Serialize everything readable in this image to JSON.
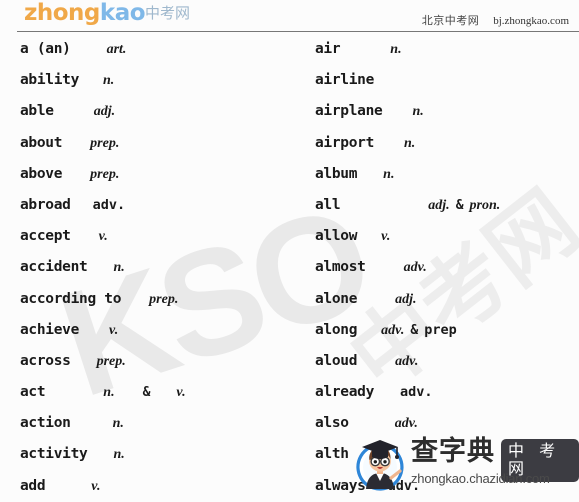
{
  "header": {
    "logo_part1": "zhong",
    "logo_part2": "kao",
    "logo_cn": "中考网",
    "site_cn": "北京中考网",
    "site_url": "bj.zhongkao.com"
  },
  "background_watermark": {
    "text": "KSO",
    "cn_text": "中考网"
  },
  "corner_watermark": {
    "brand_cn": "查字典",
    "badge_cn": "中 考 网",
    "url": "zhongkao.chazidian.com",
    "mascot": "graduate-mascot-icon"
  },
  "word_list": {
    "left_column": [
      {
        "word": "a (an)",
        "pos": "art.",
        "pos_style": "italic",
        "indent": 36
      },
      {
        "word": "ability",
        "pos": "n.",
        "pos_style": "italic",
        "indent": 24
      },
      {
        "word": "able",
        "pos": "adj.",
        "pos_style": "italic",
        "indent": 40
      },
      {
        "word": "about",
        "pos": "prep.",
        "pos_style": "italic",
        "indent": 28
      },
      {
        "word": "above",
        "pos": "prep.",
        "pos_style": "italic",
        "indent": 28
      },
      {
        "word": "abroad",
        "pos": "adv.",
        "pos_style": "upright",
        "indent": 22
      },
      {
        "word": "accept",
        "pos": "v.",
        "pos_style": "italic",
        "indent": 28
      },
      {
        "word": "accident",
        "pos": "n.",
        "pos_style": "italic",
        "indent": 26
      },
      {
        "word": "according to",
        "pos": "prep.",
        "pos_style": "italic",
        "indent": 28
      },
      {
        "word": "achieve",
        "pos": "v.",
        "pos_style": "italic",
        "indent": 30
      },
      {
        "word": "across",
        "pos": "prep.",
        "pos_style": "italic",
        "indent": 26
      },
      {
        "word": "act",
        "pos": "n.",
        "pos_style": "italic",
        "indent": 58,
        "pos2": "v.",
        "amp": "&",
        "gap2": 28,
        "gap3": 26
      },
      {
        "word": "action",
        "pos": "n.",
        "pos_style": "italic",
        "indent": 42
      },
      {
        "word": "activity",
        "pos": "n.",
        "pos_style": "italic",
        "indent": 26
      },
      {
        "word": "add",
        "pos": "v.",
        "pos_style": "italic",
        "indent": 46
      }
    ],
    "right_column": [
      {
        "word": "air",
        "pos": "n.",
        "pos_style": "italic",
        "indent": 50
      },
      {
        "word": "airline",
        "pos": "",
        "pos_style": "italic",
        "indent": 0
      },
      {
        "word": "airplane",
        "pos": "n.",
        "pos_style": "italic",
        "indent": 30
      },
      {
        "word": "airport",
        "pos": "n.",
        "pos_style": "italic",
        "indent": 30
      },
      {
        "word": "album",
        "pos": "n.",
        "pos_style": "italic",
        "indent": 26
      },
      {
        "word": "all",
        "pos": "adj.",
        "pos_style": "italic",
        "indent": 88,
        "pos2": "pron.",
        "amp": "&",
        "gap2": 6,
        "gap3": 6
      },
      {
        "word": "allow",
        "pos": "v.",
        "pos_style": "italic",
        "indent": 24
      },
      {
        "word": "almost",
        "pos": "adv.",
        "pos_style": "italic",
        "indent": 38
      },
      {
        "word": "alone",
        "pos": "adj.",
        "pos_style": "italic",
        "indent": 38
      },
      {
        "word": "along",
        "pos": "adv.",
        "pos_style": "italic",
        "indent": 24,
        "pos2": "prep",
        "amp": "&",
        "gap2": 6,
        "gap3": 6,
        "pos2_style": "upright"
      },
      {
        "word": "aloud",
        "pos": "adv.",
        "pos_style": "italic",
        "indent": 38
      },
      {
        "word": "already",
        "pos": "adv.",
        "pos_style": "upright",
        "indent": 26
      },
      {
        "word": "also",
        "pos": "adv.",
        "pos_style": "italic",
        "indent": 46
      },
      {
        "word": "alth",
        "pos": "",
        "pos_style": "italic",
        "indent": 0
      },
      {
        "word": "always",
        "pos": "adv.",
        "pos_style": "upright",
        "indent": 22
      }
    ]
  }
}
